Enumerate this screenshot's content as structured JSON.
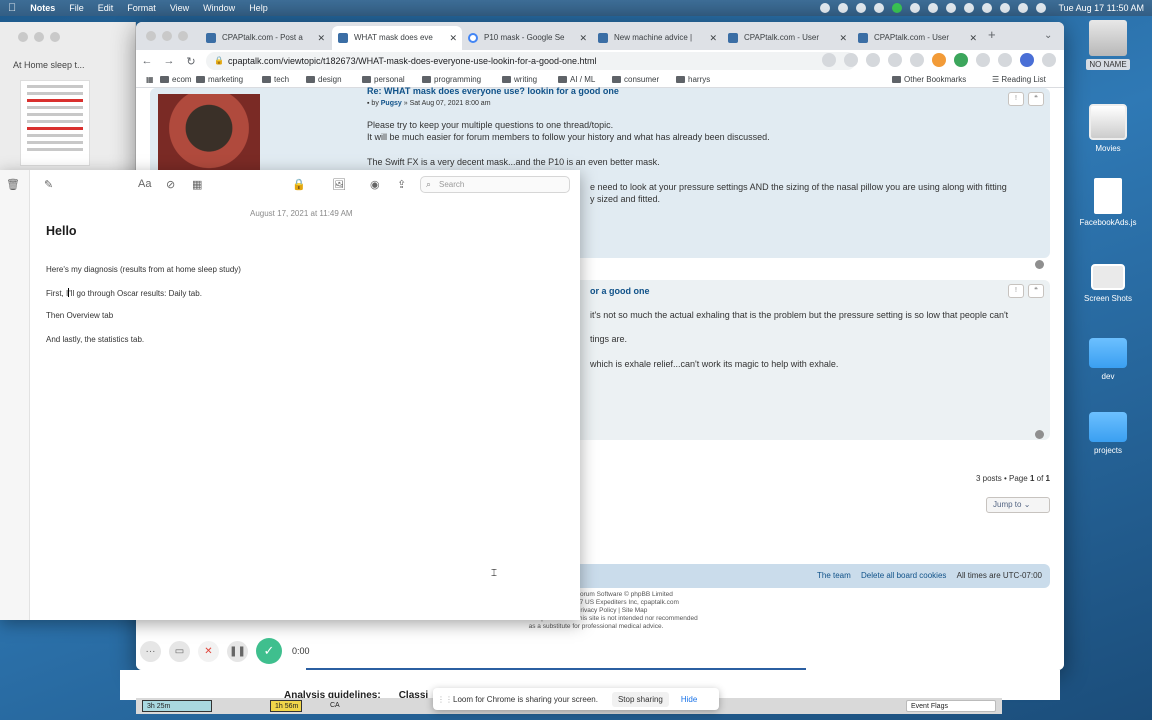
{
  "menubar": {
    "app": "Notes",
    "items": [
      "File",
      "Edit",
      "Format",
      "View",
      "Window",
      "Help"
    ],
    "clock": "Tue Aug 17  11:50 AM"
  },
  "desktop": {
    "icons": [
      {
        "label": "NO NAME"
      },
      {
        "label": "Movies"
      },
      {
        "label": "FacebookAds.js"
      },
      {
        "label": "Screen Shots"
      },
      {
        "label": "dev"
      },
      {
        "label": "projects"
      }
    ]
  },
  "browser": {
    "tabs": [
      {
        "label": "CPAPtalk.com - Post a"
      },
      {
        "label": "WHAT mask does eve"
      },
      {
        "label": "P10 mask - Google Se"
      },
      {
        "label": "New machine advice |"
      },
      {
        "label": "CPAPtalk.com - User"
      },
      {
        "label": "CPAPtalk.com - User"
      }
    ],
    "url": "cpaptalk.com/viewtopic/t182673/WHAT-mask-does-everyone-use-lookin-for-a-good-one.html",
    "bookmarks": [
      "ecom",
      "marketing",
      "tech",
      "design",
      "personal",
      "programming",
      "writing",
      "AI / ML",
      "consumer",
      "harrys"
    ],
    "bookmarks_right": [
      "Other Bookmarks",
      "Reading List"
    ]
  },
  "forum": {
    "post1": {
      "title": "Re: WHAT mask does everyone use? lookin for a good one",
      "author": "Pugsy",
      "date": "» Sat Aug 07, 2021 8:00 am",
      "lines": [
        "Please try to keep your multiple questions to one thread/topic.",
        "It will be much easier for forum members to follow your history and what has already been discussed.",
        "The Swift FX is a very decent mask...and the P10 is an even better mask."
      ],
      "lines_right": [
        "e need to look at your pressure settings AND the sizing of the nasal pillow you are using along with fitting",
        "y sized and fitted."
      ]
    },
    "post2": {
      "title": "or a good one",
      "lines": [
        "it's not so much the actual exhaling that is the problem but the pressure setting is so low that people can't",
        "tings are.",
        "which is exhale relief...can't work its magic to help with exhale."
      ]
    },
    "pagination": {
      "prefix": "3 posts • Page",
      "current": "1",
      "of": "of",
      "total": "1"
    },
    "jump_to": "Jump to",
    "footer_links": [
      "The team",
      "Delete all board cookies"
    ],
    "timezone": "All times are UTC-07:00",
    "copyright": [
      "Forum Software © phpBB Limited",
      "17 US Expediters Inc, cpaptalk.com",
      "Privacy Policy  |  Site Map",
      "The information provided on this site is not intended nor recommended",
      "as a substitute for professional medical advice."
    ]
  },
  "notes_list": {
    "title": "At Home sleep t..."
  },
  "note": {
    "search_placeholder": "Search",
    "date": "August 17, 2021 at 11:49 AM",
    "title": "Hello",
    "line1": "Here's my diagnosis (results from at home sleep study)",
    "line2_a": "First, I",
    "line2_b": "'ll go through Oscar results: Daily tab.",
    "line3": "Then Overview tab",
    "line4": "And lastly, the statistics tab."
  },
  "loom": {
    "timer": "0:00",
    "share_message": "Loom for Chrome is sharing your screen.",
    "stop_sharing": "Stop sharing",
    "hide": "Hide"
  },
  "under_page": {
    "text_a": "Analysis guidelines:",
    "text_b": "Classi"
  },
  "status_strip": {
    "seg1": "3h 25m",
    "seg2": "1h 56m",
    "seg3": "CA",
    "seg4": "Event Flags"
  }
}
